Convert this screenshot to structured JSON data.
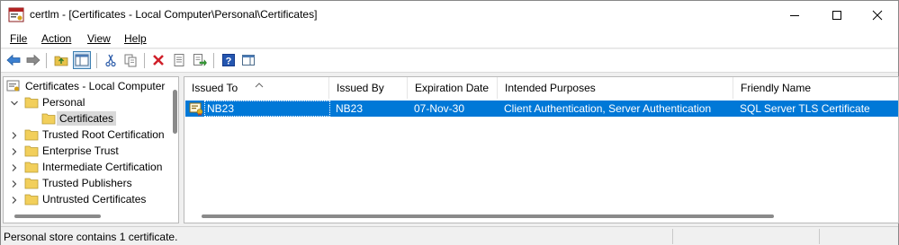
{
  "window": {
    "title": "certlm - [Certificates - Local Computer\\Personal\\Certificates]"
  },
  "window_controls": [
    "minimize-icon",
    "maximize-icon",
    "close-icon"
  ],
  "menu": [
    {
      "label": "File"
    },
    {
      "label": "Action"
    },
    {
      "label": "View"
    },
    {
      "label": "Help"
    }
  ],
  "toolbar": {
    "buttons": [
      "back-icon",
      "forward-icon",
      "up-folder-icon",
      "show-hide-console-tree-icon",
      "cut-icon",
      "copy-icon",
      "delete-icon",
      "properties-icon",
      "export-list-icon",
      "help-icon",
      "show-action-pane-icon"
    ]
  },
  "tree": {
    "root": "Certificates - Local Computer",
    "personal": "Personal",
    "certificates": "Certificates",
    "trusted_root": "Trusted Root Certification",
    "enterprise_trust": "Enterprise Trust",
    "intermediate": "Intermediate Certification",
    "trusted_publishers": "Trusted Publishers",
    "untrusted": "Untrusted Certificates"
  },
  "table": {
    "columns": {
      "issued_to": "Issued To",
      "issued_by": "Issued By",
      "expiration": "Expiration Date",
      "purposes": "Intended Purposes",
      "friendly_name": "Friendly Name"
    },
    "sort_column": "Issued To",
    "rows": [
      {
        "issued_to": "NB23",
        "issued_by": "NB23",
        "expiration": "07-Nov-30",
        "purposes": "Client Authentication, Server Authentication",
        "friendly_name": "SQL Server TLS Certificate"
      }
    ]
  },
  "status": {
    "text": "Personal store contains 1 certificate."
  },
  "colors": {
    "selection": "#0078d7",
    "selection_text": "#ffffff"
  }
}
